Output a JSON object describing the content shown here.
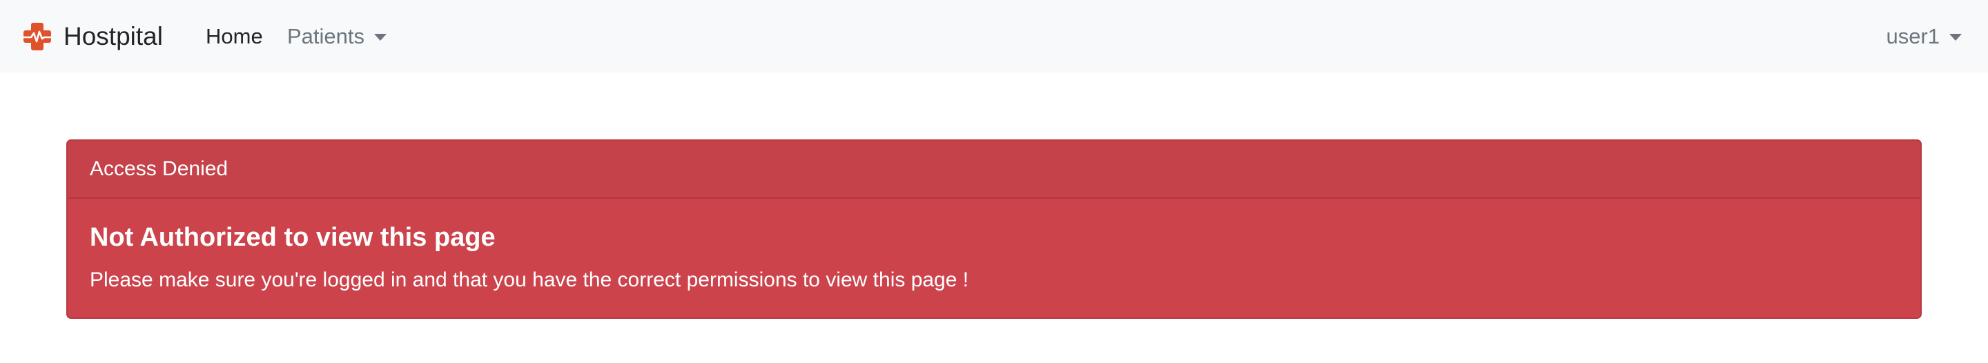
{
  "navbar": {
    "brand": {
      "name": "Hostpital",
      "logo_icon": "medical-cross-heartbeat-icon",
      "logo_color": "#e0522c"
    },
    "links": [
      {
        "label": "Home"
      },
      {
        "label": "Patients",
        "dropdown": true
      }
    ],
    "user": {
      "label": "user1",
      "dropdown": true
    }
  },
  "alert_card": {
    "header": "Access Denied",
    "title": "Not Authorized to view this page",
    "message": "Please make sure you're logged in and that you have the correct permissions to view this page !",
    "color": "#cc434c"
  }
}
